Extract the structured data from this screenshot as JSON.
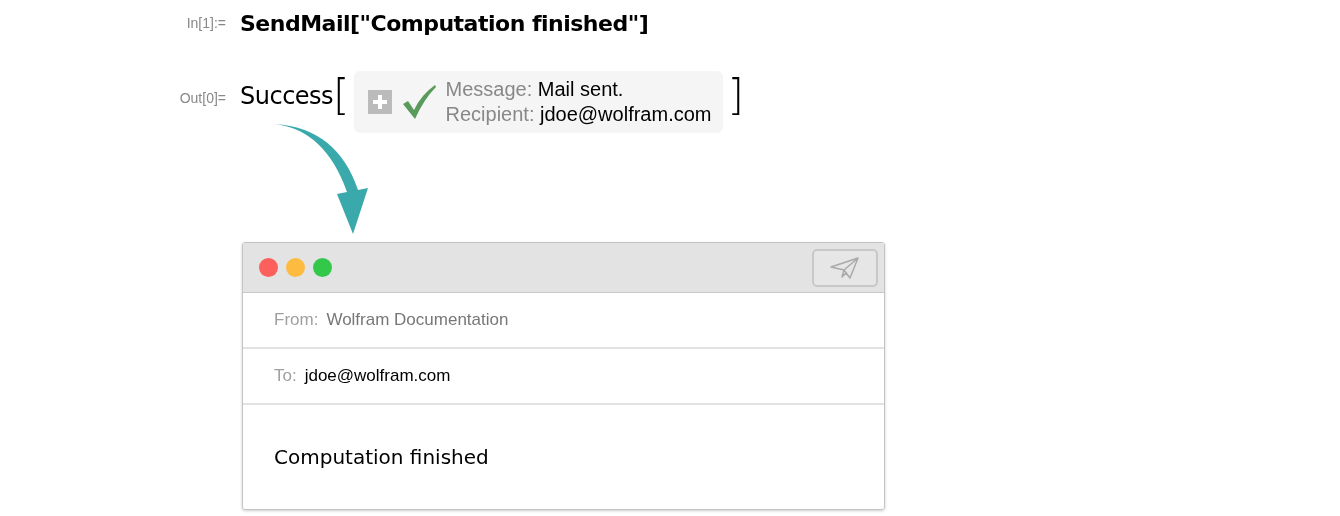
{
  "input_cell": {
    "label": "In[1]:=",
    "code": "SendMail[\"Computation finished\"]"
  },
  "output_cell": {
    "label": "Out[0]=",
    "head": "Success",
    "open_bracket": "[",
    "close_bracket": "]",
    "succeeded": true,
    "fields": [
      {
        "name": "Message:",
        "value": "Mail sent."
      },
      {
        "name": "Recipient:",
        "value": "jdoe@wolfram.com"
      }
    ]
  },
  "mail_window": {
    "from_label": "From:",
    "from": "Wolfram Documentation",
    "to_label": "To:",
    "to": "jdoe@wolfram.com",
    "body": "Computation finished"
  }
}
